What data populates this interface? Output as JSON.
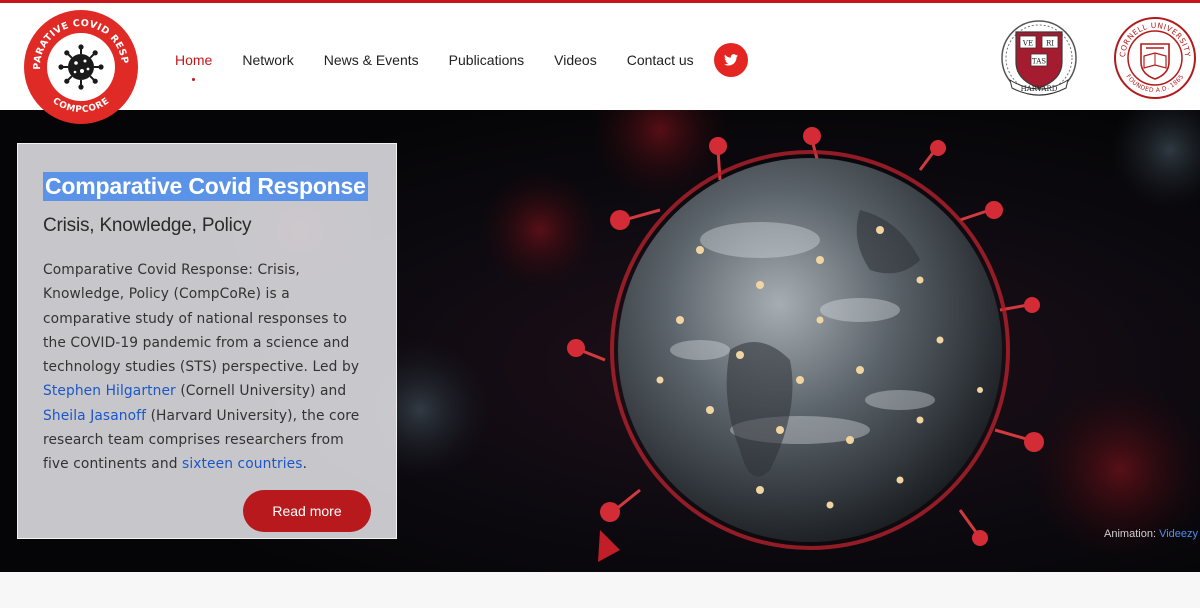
{
  "brand": {
    "logo_ring_text": "COMPARATIVE COVID RESPONSE",
    "logo_bottom_text": "COMPCORE",
    "red": "#c4161c"
  },
  "nav": {
    "items": [
      {
        "label": "Home",
        "active": true
      },
      {
        "label": "Network"
      },
      {
        "label": "News & Events"
      },
      {
        "label": "Publications"
      },
      {
        "label": "Videos"
      },
      {
        "label": "Contact us"
      }
    ],
    "social_icon": "twitter-icon"
  },
  "partners": {
    "harvard": {
      "motto_1": "VE",
      "motto_2": "RI",
      "motto_3": "TAS",
      "banner": "HARVARD"
    },
    "cornell": {
      "ring_top": "CORNELL UNIVERSITY",
      "ring_bottom": "FOUNDED A.D. 1865"
    }
  },
  "hero": {
    "title": "Comparative Covid Response",
    "subtitle": "Crisis, Knowledge, Policy",
    "body_1": "Comparative Covid Response: Crisis, Knowledge, Policy (CompCoRe) is a comparative study of national responses to the COVID-19 pandemic from a science and technology studies (STS) perspective. Led by ",
    "link_1": "Stephen Hilgartner",
    "body_2": " (Cornell University) and ",
    "link_2": "Sheila Jasanoff",
    "body_3": " (Harvard University), the core research team comprises researchers from five continents and ",
    "link_3": "sixteen countries",
    "body_4": ".",
    "cta_label": "Read more",
    "credit_label": "Animation: ",
    "credit_link": "Videezy"
  },
  "colors": {
    "accent": "#c4161c",
    "twitter_bg": "#e52521",
    "link": "#1a56c8",
    "title_highlight": "#5a93e8"
  }
}
